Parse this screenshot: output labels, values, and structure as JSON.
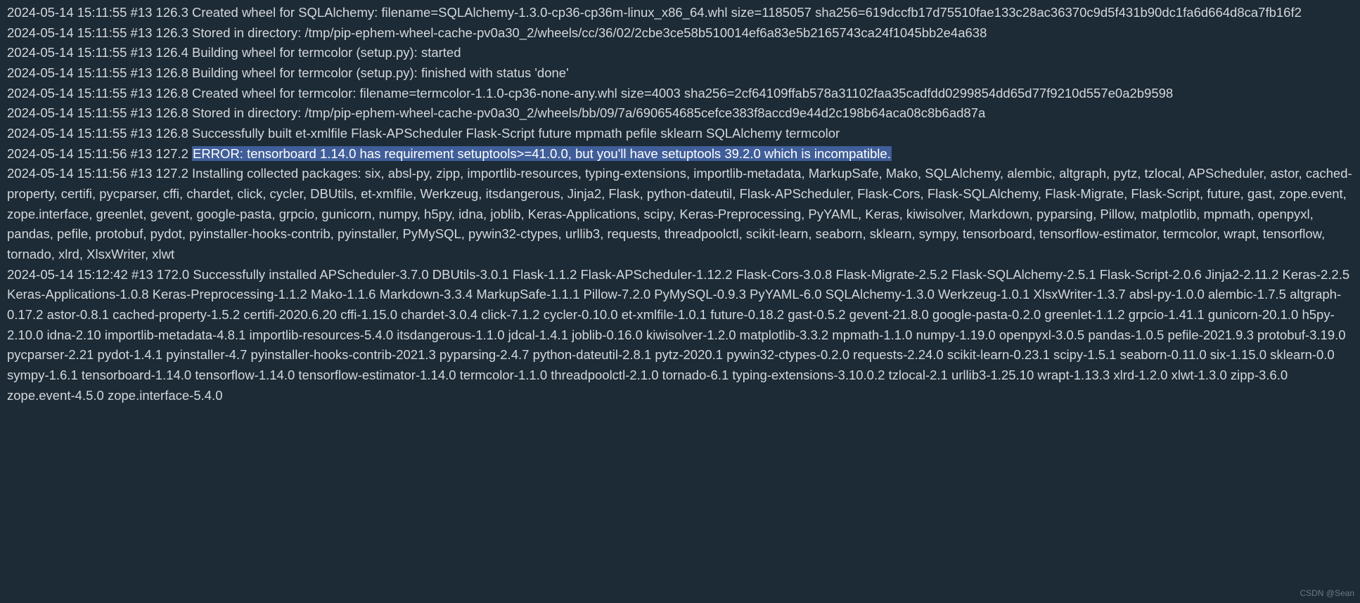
{
  "lines": [
    {
      "text": "2024-05-14 15:11:55 #13 126.3 Created wheel for SQLAlchemy: filename=SQLAlchemy-1.3.0-cp36-cp36m-linux_x86_64.whl size=1185057 sha256=619dccfb17d75510fae133c28ac36370c9d5f431b90dc1fa6d664d8ca7fb16f2"
    },
    {
      "text": "2024-05-14 15:11:55 #13 126.3 Stored in directory: /tmp/pip-ephem-wheel-cache-pv0a30_2/wheels/cc/36/02/2cbe3ce58b510014ef6a83e5b2165743ca24f1045bb2e4a638"
    },
    {
      "text": "2024-05-14 15:11:55 #13 126.4 Building wheel for termcolor (setup.py): started"
    },
    {
      "text": "2024-05-14 15:11:55 #13 126.8 Building wheel for termcolor (setup.py): finished with status 'done'"
    },
    {
      "text": "2024-05-14 15:11:55 #13 126.8 Created wheel for termcolor: filename=termcolor-1.1.0-cp36-none-any.whl size=4003 sha256=2cf64109ffab578a31102faa35cadfdd0299854dd65d77f9210d557e0a2b9598"
    },
    {
      "text": "2024-05-14 15:11:55 #13 126.8 Stored in directory: /tmp/pip-ephem-wheel-cache-pv0a30_2/wheels/bb/09/7a/690654685cefce383f8accd9e44d2c198b64aca08c8b6ad87a"
    },
    {
      "text": "2024-05-14 15:11:55 #13 126.8 Successfully built et-xmlfile Flask-APScheduler Flask-Script future mpmath pefile sklearn SQLAlchemy termcolor"
    },
    {
      "prefix": "2024-05-14 15:11:56 #13 127.2 ",
      "highlight": "ERROR: tensorboard 1.14.0 has requirement setuptools>=41.0.0, but you'll have setuptools 39.2.0 which is incompatible."
    },
    {
      "text": "2024-05-14 15:11:56 #13 127.2 Installing collected packages: six, absl-py, zipp, importlib-resources, typing-extensions, importlib-metadata, MarkupSafe, Mako, SQLAlchemy, alembic, altgraph, pytz, tzlocal, APScheduler, astor, cached-property, certifi, pycparser, cffi, chardet, click, cycler, DBUtils, et-xmlfile, Werkzeug, itsdangerous, Jinja2, Flask, python-dateutil, Flask-APScheduler, Flask-Cors, Flask-SQLAlchemy, Flask-Migrate, Flask-Script, future, gast, zope.event, zope.interface, greenlet, gevent, google-pasta, grpcio, gunicorn, numpy, h5py, idna, joblib, Keras-Applications, scipy, Keras-Preprocessing, PyYAML, Keras, kiwisolver, Markdown, pyparsing, Pillow, matplotlib, mpmath, openpyxl, pandas, pefile, protobuf, pydot, pyinstaller-hooks-contrib, pyinstaller, PyMySQL, pywin32-ctypes, urllib3, requests, threadpoolctl, scikit-learn, seaborn, sklearn, sympy, tensorboard, tensorflow-estimator, termcolor, wrapt, tensorflow, tornado, xlrd, XlsxWriter, xlwt"
    },
    {
      "text": "2024-05-14 15:12:42 #13 172.0 Successfully installed APScheduler-3.7.0 DBUtils-3.0.1 Flask-1.1.2 Flask-APScheduler-1.12.2 Flask-Cors-3.0.8 Flask-Migrate-2.5.2 Flask-SQLAlchemy-2.5.1 Flask-Script-2.0.6 Jinja2-2.11.2 Keras-2.2.5 Keras-Applications-1.0.8 Keras-Preprocessing-1.1.2 Mako-1.1.6 Markdown-3.3.4 MarkupSafe-1.1.1 Pillow-7.2.0 PyMySQL-0.9.3 PyYAML-6.0 SQLAlchemy-1.3.0 Werkzeug-1.0.1 XlsxWriter-1.3.7 absl-py-1.0.0 alembic-1.7.5 altgraph-0.17.2 astor-0.8.1 cached-property-1.5.2 certifi-2020.6.20 cffi-1.15.0 chardet-3.0.4 click-7.1.2 cycler-0.10.0 et-xmlfile-1.0.1 future-0.18.2 gast-0.5.2 gevent-21.8.0 google-pasta-0.2.0 greenlet-1.1.2 grpcio-1.41.1 gunicorn-20.1.0 h5py-2.10.0 idna-2.10 importlib-metadata-4.8.1 importlib-resources-5.4.0 itsdangerous-1.1.0 jdcal-1.4.1 joblib-0.16.0 kiwisolver-1.2.0 matplotlib-3.3.2 mpmath-1.1.0 numpy-1.19.0 openpyxl-3.0.5 pandas-1.0.5 pefile-2021.9.3 protobuf-3.19.0 pycparser-2.21 pydot-1.4.1 pyinstaller-4.7 pyinstaller-hooks-contrib-2021.3 pyparsing-2.4.7 python-dateutil-2.8.1 pytz-2020.1 pywin32-ctypes-0.2.0 requests-2.24.0 scikit-learn-0.23.1 scipy-1.5.1 seaborn-0.11.0 six-1.15.0 sklearn-0.0 sympy-1.6.1 tensorboard-1.14.0 tensorflow-1.14.0 tensorflow-estimator-1.14.0 termcolor-1.1.0 threadpoolctl-2.1.0 tornado-6.1 typing-extensions-3.10.0.2 tzlocal-2.1 urllib3-1.25.10 wrapt-1.13.3 xlrd-1.2.0 xlwt-1.3.0 zipp-3.6.0 zope.event-4.5.0 zope.interface-5.4.0"
    }
  ],
  "watermark": "CSDN @Sean"
}
